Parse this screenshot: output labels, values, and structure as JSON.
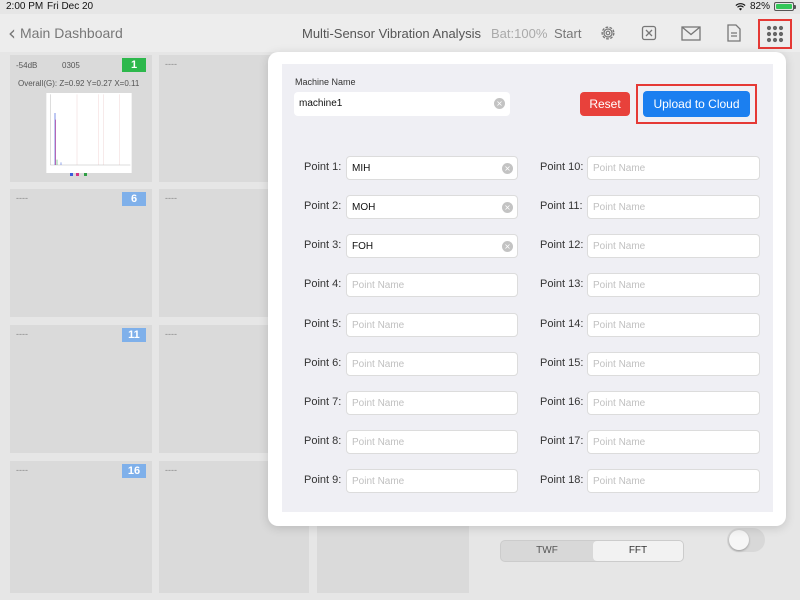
{
  "status_bar": {
    "time": "2:00 PM",
    "date": "Fri Dec 20",
    "battery": "82%"
  },
  "nav": {
    "back_label": "Main Dashboard",
    "title": "Multi-Sensor Vibration Analysis",
    "battery_text": "Bat:100%",
    "start_label": "Start",
    "icons": [
      "gear-icon",
      "close-box-icon",
      "mail-icon",
      "document-icon",
      "grid-dots-icon"
    ]
  },
  "tiles": [
    {
      "number": "1",
      "placeholder": "----",
      "db": "-54dB",
      "code": "0305",
      "overall": "Overall(G): Z=0.92 Y=0.27 X=0.11"
    },
    {
      "placeholder": "----"
    },
    {
      "number": "6",
      "placeholder": "----"
    },
    {
      "placeholder": "----"
    },
    {
      "number": "11",
      "placeholder": "----"
    },
    {
      "placeholder": "----"
    },
    {
      "number": "16",
      "placeholder": "----"
    },
    {
      "placeholder": "----"
    }
  ],
  "segment": {
    "twf": "TWF",
    "fft": "FFT",
    "selected": "FFT"
  },
  "modal": {
    "machine_name_label": "Machine Name",
    "machine_name_value": "machine1",
    "reset_label": "Reset",
    "upload_label": "Upload to Cloud",
    "placeholder": "Point Name",
    "points_left": [
      {
        "label": "Point 1:",
        "value": "MIH"
      },
      {
        "label": "Point 2:",
        "value": "MOH"
      },
      {
        "label": "Point 3:",
        "value": "FOH"
      },
      {
        "label": "Point 4:",
        "value": ""
      },
      {
        "label": "Point 5:",
        "value": ""
      },
      {
        "label": "Point 6:",
        "value": ""
      },
      {
        "label": "Point 7:",
        "value": ""
      },
      {
        "label": "Point 8:",
        "value": ""
      },
      {
        "label": "Point 9:",
        "value": ""
      }
    ],
    "points_right": [
      {
        "label": "Point 10:",
        "value": ""
      },
      {
        "label": "Point 11:",
        "value": ""
      },
      {
        "label": "Point 12:",
        "value": ""
      },
      {
        "label": "Point 13:",
        "value": ""
      },
      {
        "label": "Point 14:",
        "value": ""
      },
      {
        "label": "Point 15:",
        "value": ""
      },
      {
        "label": "Point 16:",
        "value": ""
      },
      {
        "label": "Point 17:",
        "value": ""
      },
      {
        "label": "Point 18:",
        "value": ""
      }
    ]
  },
  "colors": {
    "accent": "#1b7ff0",
    "reset": "#e8413b",
    "highlight": "#e53935",
    "tile_badge": "#7fb0ea",
    "tile_badge_active": "#2db84c"
  }
}
